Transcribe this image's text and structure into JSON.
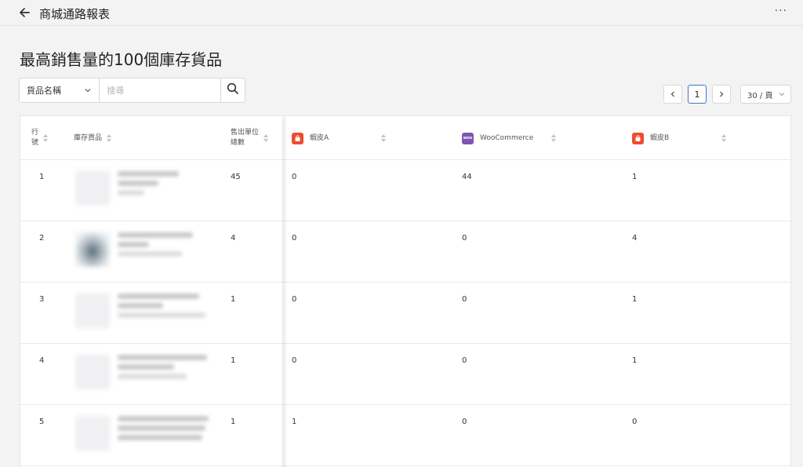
{
  "header": {
    "title": "商城通路報表",
    "more_label": "···"
  },
  "report": {
    "title": "最高銷售量的100個庫存貨品"
  },
  "filter": {
    "field_label": "貨品名稱",
    "search_placeholder": "搜尋"
  },
  "pagination": {
    "prev": "<",
    "current": "1",
    "next": ">",
    "page_size": "30 / 頁"
  },
  "table": {
    "columns": {
      "row_no": "行\n號",
      "product": "庫存貨品",
      "total_units": "售出單位\n總數",
      "channels": [
        {
          "label": "蝦皮A",
          "icon": "shopee-icon"
        },
        {
          "label": "WooCommerce",
          "icon": "woocommerce-icon"
        },
        {
          "label": "蝦皮B",
          "icon": "shopee-icon"
        }
      ]
    },
    "rows": [
      {
        "no": "1",
        "total": "45",
        "channels": [
          "0",
          "44",
          "1"
        ],
        "thumb": "light"
      },
      {
        "no": "2",
        "total": "4",
        "channels": [
          "0",
          "0",
          "4"
        ],
        "thumb": "dark"
      },
      {
        "no": "3",
        "total": "1",
        "channels": [
          "0",
          "0",
          "1"
        ],
        "thumb": "light"
      },
      {
        "no": "4",
        "total": "1",
        "channels": [
          "0",
          "0",
          "1"
        ],
        "thumb": "light"
      },
      {
        "no": "5",
        "total": "1",
        "channels": [
          "1",
          "0",
          "0"
        ],
        "thumb": "light"
      }
    ]
  },
  "colors": {
    "accent": "#3f74c8",
    "shopee": "#ee4d2d",
    "woocommerce": "#7f54b3"
  }
}
